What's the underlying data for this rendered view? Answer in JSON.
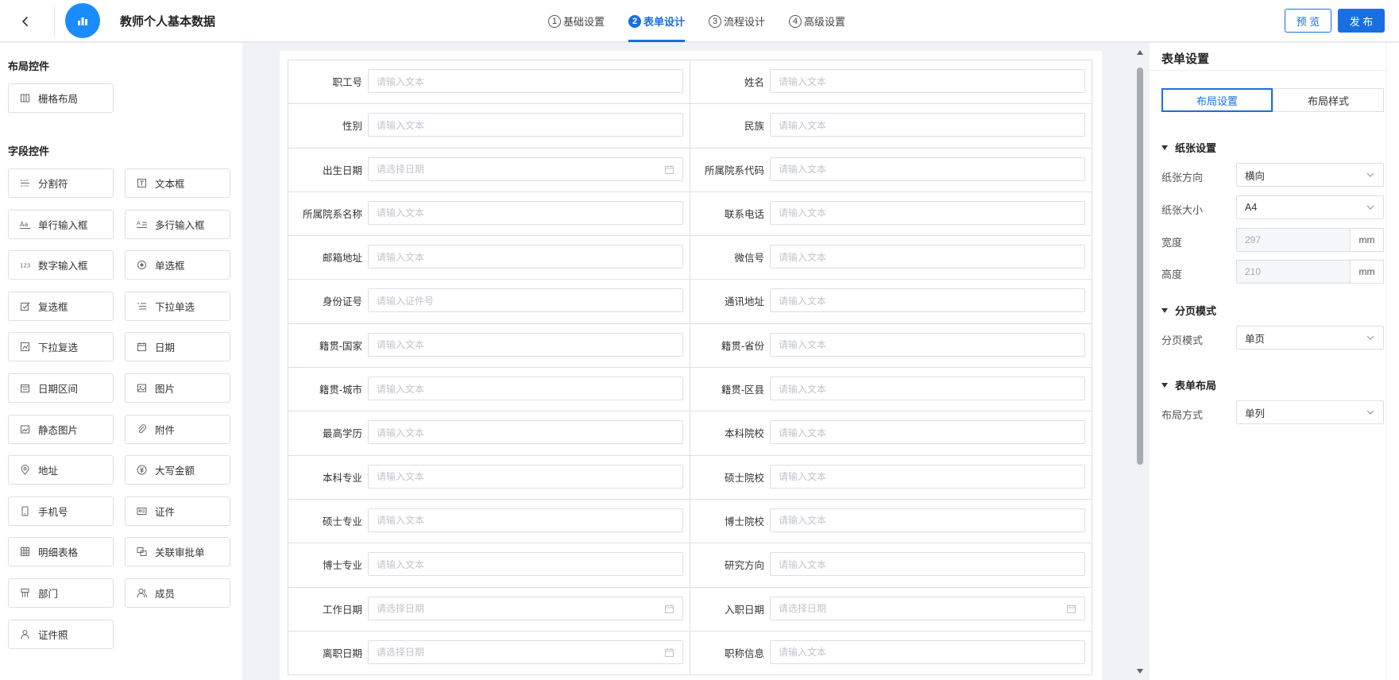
{
  "header": {
    "title": "教师个人基本数据",
    "steps": [
      {
        "num": "1",
        "label": "基础设置"
      },
      {
        "num": "2",
        "label": "表单设计"
      },
      {
        "num": "3",
        "label": "流程设计"
      },
      {
        "num": "4",
        "label": "高级设置"
      }
    ],
    "preview_label": "预 览",
    "publish_label": "发 布"
  },
  "left": {
    "layout_title": "布局控件",
    "layout_controls": [
      {
        "label": "栅格布局",
        "icon": "grid-layout-icon"
      }
    ],
    "field_title": "字段控件",
    "field_controls": [
      {
        "label": "分割符",
        "icon": "divider-icon"
      },
      {
        "label": "文本框",
        "icon": "textbox-icon"
      },
      {
        "label": "单行输入框",
        "icon": "single-line-input-icon"
      },
      {
        "label": "多行输入框",
        "icon": "multi-line-input-icon"
      },
      {
        "label": "数字输入框",
        "icon": "number-input-icon"
      },
      {
        "label": "单选框",
        "icon": "radio-icon"
      },
      {
        "label": "复选框",
        "icon": "checkbox-icon"
      },
      {
        "label": "下拉单选",
        "icon": "dropdown-single-icon"
      },
      {
        "label": "下拉复选",
        "icon": "dropdown-multi-icon"
      },
      {
        "label": "日期",
        "icon": "calendar-icon"
      },
      {
        "label": "日期区间",
        "icon": "date-range-icon"
      },
      {
        "label": "图片",
        "icon": "image-icon"
      },
      {
        "label": "静态图片",
        "icon": "static-image-icon"
      },
      {
        "label": "附件",
        "icon": "paperclip-icon"
      },
      {
        "label": "地址",
        "icon": "location-pin-icon"
      },
      {
        "label": "大写金额",
        "icon": "yuan-icon"
      },
      {
        "label": "手机号",
        "icon": "mobile-phone-icon"
      },
      {
        "label": "证件",
        "icon": "id-card-icon"
      },
      {
        "label": "明细表格",
        "icon": "table-icon"
      },
      {
        "label": "关联审批单",
        "icon": "linked-form-icon"
      },
      {
        "label": "部门",
        "icon": "department-icon"
      },
      {
        "label": "成员",
        "icon": "member-icon"
      },
      {
        "label": "证件照",
        "icon": "id-photo-icon"
      }
    ]
  },
  "form": {
    "rows": [
      [
        {
          "label": "职工号",
          "placeholder": "请输入文本",
          "type": "text"
        },
        {
          "label": "姓名",
          "placeholder": "请输入文本",
          "type": "text"
        }
      ],
      [
        {
          "label": "性别",
          "placeholder": "请输入文本",
          "type": "text"
        },
        {
          "label": "民族",
          "placeholder": "请输入文本",
          "type": "text"
        }
      ],
      [
        {
          "label": "出生日期",
          "placeholder": "请选择日期",
          "type": "date"
        },
        {
          "label": "所属院系代码",
          "placeholder": "请输入文本",
          "type": "text"
        }
      ],
      [
        {
          "label": "所属院系名称",
          "placeholder": "请输入文本",
          "type": "text"
        },
        {
          "label": "联系电话",
          "placeholder": "请输入文本",
          "type": "text"
        }
      ],
      [
        {
          "label": "邮箱地址",
          "placeholder": "请输入文本",
          "type": "text"
        },
        {
          "label": "微信号",
          "placeholder": "请输入文本",
          "type": "text"
        }
      ],
      [
        {
          "label": "身份证号",
          "placeholder": "请输入证件号",
          "type": "text"
        },
        {
          "label": "通讯地址",
          "placeholder": "请输入文本",
          "type": "text"
        }
      ],
      [
        {
          "label": "籍贯-国家",
          "placeholder": "请输入文本",
          "type": "text"
        },
        {
          "label": "籍贯-省份",
          "placeholder": "请输入文本",
          "type": "text"
        }
      ],
      [
        {
          "label": "籍贯-城市",
          "placeholder": "请输入文本",
          "type": "text"
        },
        {
          "label": "籍贯-区县",
          "placeholder": "请输入文本",
          "type": "text"
        }
      ],
      [
        {
          "label": "最高学历",
          "placeholder": "请输入文本",
          "type": "text"
        },
        {
          "label": "本科院校",
          "placeholder": "请输入文本",
          "type": "text"
        }
      ],
      [
        {
          "label": "本科专业",
          "placeholder": "请输入文本",
          "type": "text"
        },
        {
          "label": "硕士院校",
          "placeholder": "请输入文本",
          "type": "text"
        }
      ],
      [
        {
          "label": "硕士专业",
          "placeholder": "请输入文本",
          "type": "text"
        },
        {
          "label": "博士院校",
          "placeholder": "请输入文本",
          "type": "text"
        }
      ],
      [
        {
          "label": "博士专业",
          "placeholder": "请输入文本",
          "type": "text"
        },
        {
          "label": "研究方向",
          "placeholder": "请输入文本",
          "type": "text"
        }
      ],
      [
        {
          "label": "工作日期",
          "placeholder": "请选择日期",
          "type": "date"
        },
        {
          "label": "入职日期",
          "placeholder": "请选择日期",
          "type": "date"
        }
      ],
      [
        {
          "label": "离职日期",
          "placeholder": "请选择日期",
          "type": "date"
        },
        {
          "label": "职称信息",
          "placeholder": "请输入文本",
          "type": "text"
        }
      ]
    ]
  },
  "right": {
    "title": "表单设置",
    "tabs": [
      "布局设置",
      "布局样式"
    ],
    "paper_group": "纸张设置",
    "paper_direction_label": "纸张方向",
    "paper_direction_value": "横向",
    "paper_size_label": "纸张大小",
    "paper_size_value": "A4",
    "width_label": "宽度",
    "width_value": "297",
    "height_label": "高度",
    "height_value": "210",
    "unit": "mm",
    "page_group": "分页模式",
    "page_mode_label": "分页模式",
    "page_mode_value": "单页",
    "layout_group": "表单布局",
    "layout_mode_label": "布局方式",
    "layout_mode_value": "单列"
  },
  "colors": {
    "accent": "#1a6fe0",
    "logo": "#1a8cff"
  }
}
